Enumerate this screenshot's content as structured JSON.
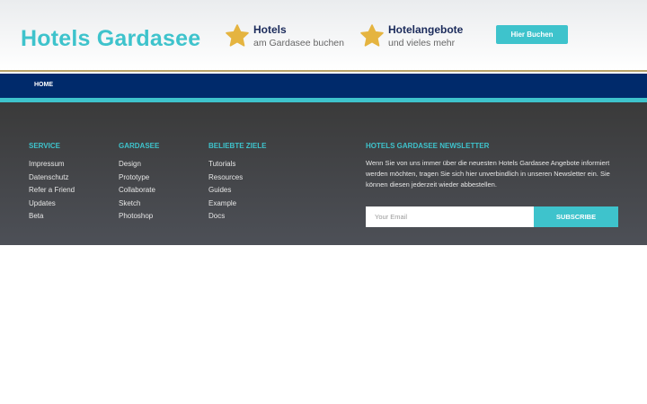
{
  "header": {
    "brand": "Hotels Gardasee",
    "features": [
      {
        "icon": "star-icon",
        "title": "Hotels",
        "subtitle": "am Gardasee buchen"
      },
      {
        "icon": "star-icon",
        "title": "Hotelangebote",
        "subtitle": "und vieles mehr"
      }
    ],
    "cta_label": "Hier Buchen"
  },
  "nav": {
    "items": [
      "HOME"
    ]
  },
  "footer": {
    "columns": [
      {
        "title": "SERVICE",
        "links": [
          "Impressum",
          "Datenschutz",
          "Refer a Friend",
          "Updates",
          "Beta"
        ]
      },
      {
        "title": "GARDASEE",
        "links": [
          "Design",
          "Prototype",
          "Collaborate",
          "Sketch",
          "Photoshop"
        ]
      },
      {
        "title": "BELIEBTE ZIELE",
        "links": [
          "Tutorials",
          "Resources",
          "Guides",
          "Example",
          "Docs"
        ]
      }
    ],
    "newsletter": {
      "title": "HOTELS GARDASEE NEWSLETTER",
      "text": "Wenn Sie von uns immer über die neuesten Hotels Gardasee Angebote informiert werden möchten, tragen Sie sich hier unverbindlich in unseren Newsletter ein. Sie können diesen jederzeit wieder abbestellen.",
      "email_placeholder": "Your Email",
      "subscribe_label": "SUBSCRIBE"
    }
  },
  "colors": {
    "accent": "#3ec3cc",
    "nav": "#002a6b",
    "star": "#e5b440",
    "footer": "#3f4044"
  }
}
